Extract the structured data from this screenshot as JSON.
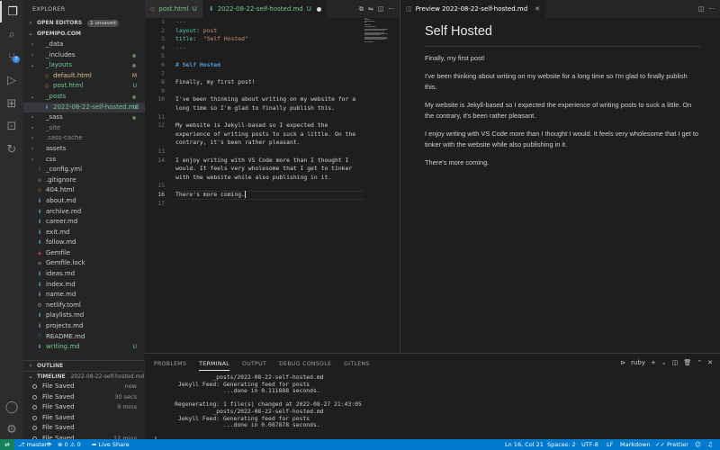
{
  "activity_bar": {
    "items": [
      {
        "name": "explorer-icon",
        "active": true
      },
      {
        "name": "search-icon",
        "active": false
      },
      {
        "name": "source-control-icon",
        "active": false,
        "badge": "7"
      },
      {
        "name": "run-debug-icon",
        "active": false
      },
      {
        "name": "extensions-icon",
        "active": false
      },
      {
        "name": "remote-explorer-icon",
        "active": false
      },
      {
        "name": "live-share-icon",
        "active": false
      }
    ],
    "bottom": [
      {
        "name": "account-icon"
      },
      {
        "name": "settings-gear-icon"
      }
    ]
  },
  "sidebar": {
    "title": "EXPLORER",
    "more": "···",
    "open_editors": {
      "label": "OPEN EDITORS",
      "badge": "1 unsaved"
    },
    "workspace": "OPEMIPO.COM",
    "tree": [
      {
        "label": "_data",
        "kind": "folder",
        "open": false,
        "indent": 0,
        "icon_color": "#b0b0b0"
      },
      {
        "label": "_includes",
        "kind": "folder",
        "open": false,
        "indent": 0,
        "dot": true
      },
      {
        "label": "_layouts",
        "kind": "folder",
        "open": true,
        "indent": 0,
        "dot": true,
        "color": "#73c991"
      },
      {
        "label": "default.html",
        "kind": "file",
        "indent": 1,
        "icon": "◇",
        "icon_color": "#e37933",
        "mark": "M",
        "mark_color": "#e2c08d",
        "color": "#e2c08d"
      },
      {
        "label": "post.html",
        "kind": "file",
        "indent": 1,
        "icon": "◇",
        "icon_color": "#e37933",
        "mark": "U",
        "mark_color": "#73c991",
        "color": "#73c991"
      },
      {
        "label": "_posts",
        "kind": "folder",
        "open": true,
        "indent": 0,
        "dot": true,
        "color": "#73c991"
      },
      {
        "label": "2022-08-22-self-hosted.md",
        "kind": "file",
        "indent": 1,
        "icon": "⬇",
        "icon_color": "#519aba",
        "mark": "U",
        "mark_color": "#73c991",
        "color": "#73c991",
        "selected": true
      },
      {
        "label": "_sass",
        "kind": "folder",
        "open": false,
        "indent": 0,
        "dot": true
      },
      {
        "label": "_site",
        "kind": "folder",
        "open": false,
        "indent": 0,
        "color": "#8c8c8c"
      },
      {
        "label": ".sass-cache",
        "kind": "folder",
        "open": false,
        "indent": 0,
        "color": "#8c8c8c"
      },
      {
        "label": "assets",
        "kind": "folder",
        "open": false,
        "indent": 0
      },
      {
        "label": "css",
        "kind": "folder",
        "open": false,
        "indent": 0
      },
      {
        "label": "_config.yml",
        "kind": "file",
        "indent": 0,
        "icon": "!",
        "icon_color": "#a074c4"
      },
      {
        "label": ".gitignore",
        "kind": "file",
        "indent": 0,
        "icon": "◆",
        "icon_color": "#41535b"
      },
      {
        "label": "404.html",
        "kind": "file",
        "indent": 0,
        "icon": "◇",
        "icon_color": "#e37933"
      },
      {
        "label": "about.md",
        "kind": "file",
        "indent": 0,
        "icon": "⬇",
        "icon_color": "#519aba"
      },
      {
        "label": "archive.md",
        "kind": "file",
        "indent": 0,
        "icon": "⬇",
        "icon_color": "#519aba"
      },
      {
        "label": "career.md",
        "kind": "file",
        "indent": 0,
        "icon": "⬇",
        "icon_color": "#519aba"
      },
      {
        "label": "exit.md",
        "kind": "file",
        "indent": 0,
        "icon": "⬇",
        "icon_color": "#519aba"
      },
      {
        "label": "follow.md",
        "kind": "file",
        "indent": 0,
        "icon": "⬇",
        "icon_color": "#519aba"
      },
      {
        "label": "Gemfile",
        "kind": "file",
        "indent": 0,
        "icon": "◈",
        "icon_color": "#cc3e44"
      },
      {
        "label": "Gemfile.lock",
        "kind": "file",
        "indent": 0,
        "icon": "≡",
        "icon_color": "#8c8c8c"
      },
      {
        "label": "ideas.md",
        "kind": "file",
        "indent": 0,
        "icon": "⬇",
        "icon_color": "#519aba"
      },
      {
        "label": "index.md",
        "kind": "file",
        "indent": 0,
        "icon": "⬇",
        "icon_color": "#519aba"
      },
      {
        "label": "name.md",
        "kind": "file",
        "indent": 0,
        "icon": "⬇",
        "icon_color": "#519aba"
      },
      {
        "label": "netlify.toml",
        "kind": "file",
        "indent": 0,
        "icon": "⚙",
        "icon_color": "#8c8c8c"
      },
      {
        "label": "playlists.md",
        "kind": "file",
        "indent": 0,
        "icon": "⬇",
        "icon_color": "#519aba"
      },
      {
        "label": "projects.md",
        "kind": "file",
        "indent": 0,
        "icon": "⬇",
        "icon_color": "#519aba"
      },
      {
        "label": "README.md",
        "kind": "file",
        "indent": 0,
        "icon": "ⓘ",
        "icon_color": "#519aba"
      },
      {
        "label": "writing.md",
        "kind": "file",
        "indent": 0,
        "icon": "⬇",
        "icon_color": "#519aba",
        "mark": "U",
        "mark_color": "#73c991",
        "color": "#73c991"
      }
    ],
    "outline_label": "OUTLINE",
    "timeline": {
      "label": "TIMELINE",
      "file": "2022-08-22-self-hosted.md",
      "entries": [
        {
          "label": "File Saved",
          "time": "now"
        },
        {
          "label": "File Saved",
          "time": "30 secs"
        },
        {
          "label": "File Saved",
          "time": "9 mins"
        },
        {
          "label": "File Saved",
          "time": ""
        },
        {
          "label": "File Saved",
          "time": ""
        },
        {
          "label": "File Saved",
          "time": "12 mins"
        }
      ]
    }
  },
  "editor": {
    "tabs": [
      {
        "label": "post.html",
        "status": "U",
        "icon": "◇",
        "icon_color": "#e37933",
        "active": false,
        "dirty": false
      },
      {
        "label": "2022-08-22-self-hosted.md",
        "status": "U",
        "icon": "⬇",
        "icon_color": "#519aba",
        "active": true,
        "dirty": true
      }
    ],
    "lines": [
      {
        "n": "1",
        "parts": [
          {
            "t": "---",
            "c": "k-dash"
          }
        ]
      },
      {
        "n": "2",
        "parts": [
          {
            "t": "layout",
            "c": "k-key"
          },
          {
            "t": ": ",
            "c": ""
          },
          {
            "t": "post",
            "c": "k-str"
          }
        ]
      },
      {
        "n": "3",
        "parts": [
          {
            "t": "title",
            "c": "k-key"
          },
          {
            "t": ":  ",
            "c": ""
          },
          {
            "t": "\"Self Hosted\"",
            "c": "k-str"
          }
        ]
      },
      {
        "n": "4",
        "parts": [
          {
            "t": "---",
            "c": "k-dash"
          }
        ]
      },
      {
        "n": "5",
        "parts": []
      },
      {
        "n": "6",
        "parts": [
          {
            "t": "# Self Hosted",
            "c": "k-head"
          }
        ]
      },
      {
        "n": "7",
        "parts": []
      },
      {
        "n": "8",
        "parts": [
          {
            "t": "Finally, my first post!",
            "c": ""
          }
        ]
      },
      {
        "n": "9",
        "parts": []
      },
      {
        "n": "10",
        "parts": [
          {
            "t": "I've been thinking about writing on my website for a",
            "c": ""
          }
        ]
      },
      {
        "n": "",
        "parts": [
          {
            "t": "long time so I'm glad to finally publish this.",
            "c": ""
          }
        ]
      },
      {
        "n": "11",
        "parts": []
      },
      {
        "n": "12",
        "parts": [
          {
            "t": "My website is Jekyll-based so I expected the",
            "c": ""
          }
        ]
      },
      {
        "n": "",
        "parts": [
          {
            "t": "experience of writing posts to suck a little. On the",
            "c": ""
          }
        ]
      },
      {
        "n": "",
        "parts": [
          {
            "t": "contrary, it's been rather pleasant.",
            "c": ""
          }
        ]
      },
      {
        "n": "13",
        "parts": []
      },
      {
        "n": "14",
        "parts": [
          {
            "t": "I enjoy writing with VS Code more than I thought I",
            "c": ""
          }
        ]
      },
      {
        "n": "",
        "parts": [
          {
            "t": "would. It feels very wholesome that I get to tinker",
            "c": ""
          }
        ]
      },
      {
        "n": "",
        "parts": [
          {
            "t": "with the website while also publishing in it.",
            "c": ""
          }
        ]
      },
      {
        "n": "15",
        "parts": []
      },
      {
        "n": "16",
        "parts": [
          {
            "t": "There's more coming.",
            "c": ""
          }
        ],
        "current": true
      },
      {
        "n": "17",
        "parts": []
      }
    ]
  },
  "preview": {
    "tab_label": "Preview 2022-08-22-self-hosted.md",
    "heading": "Self Hosted",
    "paragraphs": [
      "Finally, my first post!",
      "I've been thinking about writing on my website for a long time so I'm glad to finally publish this.",
      "My website is Jekyll-based so I expected the experience of writing posts to suck a little. On the contrary, it's been rather pleasant.",
      "I enjoy writing with VS Code more than I thought I would. It feels very wholesome that I get to tinker with the website while also publishing in it.",
      "There's more coming."
    ]
  },
  "panel": {
    "tabs": [
      {
        "label": "PROBLEMS",
        "active": false
      },
      {
        "label": "TERMINAL",
        "active": true
      },
      {
        "label": "OUTPUT",
        "active": false
      },
      {
        "label": "DEBUG CONSOLE",
        "active": false
      },
      {
        "label": "GITLENS",
        "active": false
      }
    ],
    "shell": "ruby",
    "terminal_lines": [
      "                 _posts/2022-08-22-self-hosted.md",
      "       Jekyll Feed: Generating feed for posts",
      "                    ...done in 0.111888 seconds.",
      "",
      "      Regenerating: 1 file(s) changed at 2022-08-27 21:43:05",
      "                 _posts/2022-08-22-self-hosted.md",
      "       Jekyll Feed: Generating feed for posts",
      "                    ...done in 0.087878 seconds.",
      "",
      "▯"
    ]
  },
  "status_bar": {
    "remote": "⇄",
    "branch": "master*",
    "sync": "⟳",
    "errors": "0",
    "warnings": "0",
    "live_share": "Live Share",
    "position": "Ln 16, Col 21",
    "spaces": "Spaces: 2",
    "encoding": "UTF-8",
    "eol": "LF",
    "language": "Markdown",
    "prettier": "Prettier"
  }
}
